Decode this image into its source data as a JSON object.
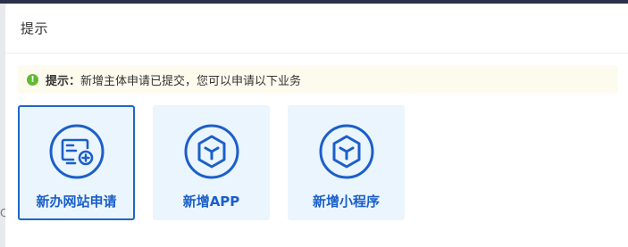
{
  "dialog": {
    "title": "提示"
  },
  "notice": {
    "label": "提示：",
    "message": "新增主体申请已提交，您可以申请以下业务"
  },
  "cards": [
    {
      "label": "新办网站申请",
      "icon": "website-icon",
      "selected": true
    },
    {
      "label": "新增APP",
      "icon": "app-cube-icon",
      "selected": false
    },
    {
      "label": "新增小程序",
      "icon": "miniprogram-cube-icon",
      "selected": false
    }
  ],
  "colors": {
    "accent": "#1b5fc9",
    "card_bg": "#eaf5fd",
    "notice_bg": "#fdfbee",
    "success": "#62b935"
  }
}
